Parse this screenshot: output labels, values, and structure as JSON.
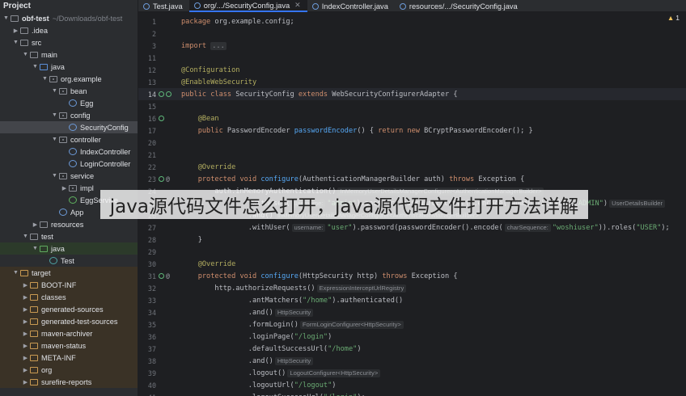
{
  "project": {
    "title": "Project",
    "tree": [
      {
        "label": "obf-test",
        "suffix": "~/Downloads/obf-test",
        "depth": 0,
        "arrow": "down",
        "icon": "folder-icon",
        "bold": true
      },
      {
        "label": ".idea",
        "depth": 1,
        "arrow": "right",
        "icon": "folder-icon"
      },
      {
        "label": "src",
        "depth": 1,
        "arrow": "down",
        "icon": "folder-icon"
      },
      {
        "label": "main",
        "depth": 2,
        "arrow": "down",
        "icon": "folder-icon"
      },
      {
        "label": "java",
        "depth": 3,
        "arrow": "down",
        "icon": "source-folder-icon"
      },
      {
        "label": "org.example",
        "depth": 4,
        "arrow": "down",
        "icon": "package-icon"
      },
      {
        "label": "bean",
        "depth": 5,
        "arrow": "down",
        "icon": "package-icon"
      },
      {
        "label": "Egg",
        "depth": 6,
        "arrow": "",
        "icon": "class-icon"
      },
      {
        "label": "config",
        "depth": 5,
        "arrow": "down",
        "icon": "package-icon"
      },
      {
        "label": "SecurityConfig",
        "depth": 6,
        "arrow": "",
        "icon": "class-icon",
        "selected": true
      },
      {
        "label": "controller",
        "depth": 5,
        "arrow": "down",
        "icon": "package-icon"
      },
      {
        "label": "IndexController",
        "depth": 6,
        "arrow": "",
        "icon": "class-icon"
      },
      {
        "label": "LoginController",
        "depth": 6,
        "arrow": "",
        "icon": "class-icon"
      },
      {
        "label": "service",
        "depth": 5,
        "arrow": "down",
        "icon": "package-icon"
      },
      {
        "label": "impl",
        "depth": 6,
        "arrow": "right",
        "icon": "package-icon"
      },
      {
        "label": "EggService",
        "depth": 6,
        "arrow": "",
        "icon": "interface-icon"
      },
      {
        "label": "App",
        "depth": 5,
        "arrow": "",
        "icon": "class-icon"
      },
      {
        "label": "resources",
        "depth": 3,
        "arrow": "right",
        "icon": "folder-icon"
      },
      {
        "label": "test",
        "depth": 2,
        "arrow": "down",
        "icon": "folder-icon"
      },
      {
        "label": "java",
        "depth": 3,
        "arrow": "down",
        "icon": "test-folder-icon",
        "band": "green"
      },
      {
        "label": "Test",
        "depth": 4,
        "arrow": "",
        "icon": "test-class-icon"
      },
      {
        "label": "target",
        "depth": 1,
        "arrow": "down",
        "icon": "excluded-folder-icon",
        "band": "tan"
      },
      {
        "label": "BOOT-INF",
        "depth": 2,
        "arrow": "right",
        "icon": "excluded-folder-icon",
        "band": "tan"
      },
      {
        "label": "classes",
        "depth": 2,
        "arrow": "right",
        "icon": "excluded-folder-icon",
        "band": "tan"
      },
      {
        "label": "generated-sources",
        "depth": 2,
        "arrow": "right",
        "icon": "excluded-folder-icon",
        "band": "tan"
      },
      {
        "label": "generated-test-sources",
        "depth": 2,
        "arrow": "right",
        "icon": "excluded-folder-icon",
        "band": "tan"
      },
      {
        "label": "maven-archiver",
        "depth": 2,
        "arrow": "right",
        "icon": "excluded-folder-icon",
        "band": "tan"
      },
      {
        "label": "maven-status",
        "depth": 2,
        "arrow": "right",
        "icon": "excluded-folder-icon",
        "band": "tan"
      },
      {
        "label": "META-INF",
        "depth": 2,
        "arrow": "right",
        "icon": "excluded-folder-icon",
        "band": "tan"
      },
      {
        "label": "org",
        "depth": 2,
        "arrow": "right",
        "icon": "excluded-folder-icon",
        "band": "tan"
      },
      {
        "label": "surefire-reports",
        "depth": 2,
        "arrow": "right",
        "icon": "excluded-folder-icon",
        "band": "tan"
      }
    ]
  },
  "tabs": [
    {
      "label": "Test.java",
      "active": false,
      "close": false
    },
    {
      "label": "org/.../SecurityConfig.java",
      "active": true,
      "close": true
    },
    {
      "label": "IndexController.java",
      "active": false,
      "close": false
    },
    {
      "label": "resources/.../SecurityConfig.java",
      "active": false,
      "close": false
    }
  ],
  "inspection": {
    "icon": "warning-icon",
    "count": "1"
  },
  "editor": {
    "lines": [
      {
        "n": "1",
        "segs": [
          [
            "kw",
            "package "
          ],
          [
            "cls",
            "org.example.config;"
          ]
        ]
      },
      {
        "n": "2",
        "segs": []
      },
      {
        "n": "3",
        "segs": [
          [
            "kw",
            "import "
          ],
          [
            "fold",
            "..."
          ]
        ]
      },
      {
        "n": "11",
        "segs": []
      },
      {
        "n": "12",
        "segs": [
          [
            "ann",
            "@Configuration"
          ]
        ]
      },
      {
        "n": "13",
        "segs": [
          [
            "ann",
            "@EnableWebSecurity"
          ]
        ]
      },
      {
        "n": "14",
        "current": true,
        "gutter": [
          "bean-icon",
          "search-icon"
        ],
        "segs": [
          [
            "kw",
            "public class "
          ],
          [
            "cls",
            "SecurityConfig"
          ],
          [
            "kw",
            " extends "
          ],
          [
            "cls",
            "WebSecurityConfigurerAdapter {"
          ]
        ]
      },
      {
        "n": "15",
        "segs": []
      },
      {
        "n": "16",
        "gutter": [
          "bean-icon"
        ],
        "segs": [
          [
            "pn",
            "    "
          ],
          [
            "ann",
            "@Bean"
          ]
        ]
      },
      {
        "n": "17",
        "segs": [
          [
            "pn",
            "    "
          ],
          [
            "kw",
            "public "
          ],
          [
            "cls",
            "PasswordEncoder "
          ],
          [
            "fn",
            "passwordEncoder"
          ],
          [
            "pn",
            "() { "
          ],
          [
            "kw",
            "return new "
          ],
          [
            "cls",
            "BCryptPasswordEncoder(); }"
          ]
        ]
      },
      {
        "n": "20",
        "segs": []
      },
      {
        "n": "21",
        "segs": []
      },
      {
        "n": "22",
        "segs": [
          [
            "pn",
            "    "
          ],
          [
            "ann",
            "@Override"
          ]
        ]
      },
      {
        "n": "23",
        "gutter": [
          "override-icon",
          "at-icon"
        ],
        "segs": [
          [
            "pn",
            "    "
          ],
          [
            "kw",
            "protected void "
          ],
          [
            "fn",
            "configure"
          ],
          [
            "pn",
            "(AuthenticationManagerBuilder auth) "
          ],
          [
            "kw",
            "throws "
          ],
          [
            "cls",
            "Exception {"
          ]
        ]
      },
      {
        "n": "24",
        "segs": [
          [
            "pn",
            "        auth.inMemoryAuthentication()"
          ],
          [
            "hint",
            "InMemoryUserDetailsManagerConfigurer<AuthenticationManagerBuilder>"
          ]
        ]
      },
      {
        "n": "25",
        "segs": [
          [
            "pn",
            "                .withUser("
          ],
          [
            "hint",
            "username:"
          ],
          [
            "str",
            "\"admin\""
          ],
          [
            "pn",
            ").password(passwordEncoder().encode(\"admin\")).roles("
          ],
          [
            "str",
            "\"ADMIN\""
          ],
          [
            "pn",
            ")"
          ],
          [
            "hint",
            "UserDetailsBuilder"
          ]
        ]
      },
      {
        "n": "26",
        "segs": [
          [
            "pn",
            "                .and()"
          ],
          [
            "hint",
            "InMemoryUserDetailsManagerConfigurer<AuthenticationManagerBuilder>"
          ]
        ]
      },
      {
        "n": "27",
        "segs": [
          [
            "pn",
            "                .withUser("
          ],
          [
            "hint",
            "username:"
          ],
          [
            "str",
            "\"user\""
          ],
          [
            "pn",
            ").password(passwordEncoder().encode("
          ],
          [
            "hint",
            "charSequence:"
          ],
          [
            "str",
            "\"woshiuser\""
          ],
          [
            "pn",
            ")).roles("
          ],
          [
            "str",
            "\"USER\""
          ],
          [
            "pn",
            ");"
          ]
        ]
      },
      {
        "n": "28",
        "segs": [
          [
            "pn",
            "    }"
          ]
        ]
      },
      {
        "n": "29",
        "segs": []
      },
      {
        "n": "30",
        "segs": [
          [
            "pn",
            "    "
          ],
          [
            "ann",
            "@Override"
          ]
        ]
      },
      {
        "n": "31",
        "gutter": [
          "override-icon",
          "at-icon"
        ],
        "segs": [
          [
            "pn",
            "    "
          ],
          [
            "kw",
            "protected void "
          ],
          [
            "fn",
            "configure"
          ],
          [
            "pn",
            "(HttpSecurity http) "
          ],
          [
            "kw",
            "throws "
          ],
          [
            "cls",
            "Exception {"
          ]
        ]
      },
      {
        "n": "32",
        "segs": [
          [
            "pn",
            "        http.authorizeRequests()"
          ],
          [
            "hint",
            "ExpressionInterceptUrlRegistry"
          ]
        ]
      },
      {
        "n": "33",
        "segs": [
          [
            "pn",
            "                .antMatchers("
          ],
          [
            "str",
            "\"/home\""
          ],
          [
            "pn",
            ").authenticated()"
          ]
        ]
      },
      {
        "n": "34",
        "segs": [
          [
            "pn",
            "                .and()"
          ],
          [
            "hint",
            "HttpSecurity"
          ]
        ]
      },
      {
        "n": "35",
        "segs": [
          [
            "pn",
            "                .formLogin()"
          ],
          [
            "hint",
            "FormLoginConfigurer<HttpSecurity>"
          ]
        ]
      },
      {
        "n": "36",
        "segs": [
          [
            "pn",
            "                .loginPage("
          ],
          [
            "str",
            "\"/login\""
          ],
          [
            "pn",
            ")"
          ]
        ]
      },
      {
        "n": "37",
        "segs": [
          [
            "pn",
            "                .defaultSuccessUrl("
          ],
          [
            "str",
            "\"/home\""
          ],
          [
            "pn",
            ")"
          ]
        ]
      },
      {
        "n": "38",
        "segs": [
          [
            "pn",
            "                .and()"
          ],
          [
            "hint",
            "HttpSecurity"
          ]
        ]
      },
      {
        "n": "39",
        "segs": [
          [
            "pn",
            "                .logout()"
          ],
          [
            "hint",
            "LogoutConfigurer<HttpSecurity>"
          ]
        ]
      },
      {
        "n": "40",
        "segs": [
          [
            "pn",
            "                .logoutUrl("
          ],
          [
            "str",
            "\"/logout\""
          ],
          [
            "pn",
            ")"
          ]
        ]
      },
      {
        "n": "41",
        "segs": [
          [
            "pn",
            "                .logoutSuccessUrl("
          ],
          [
            "str",
            "\"/login\""
          ],
          [
            "pn",
            ");"
          ]
        ]
      }
    ]
  },
  "overlay": {
    "text": "java源代码文件怎么打开，java源代码文件打开方法详解"
  }
}
